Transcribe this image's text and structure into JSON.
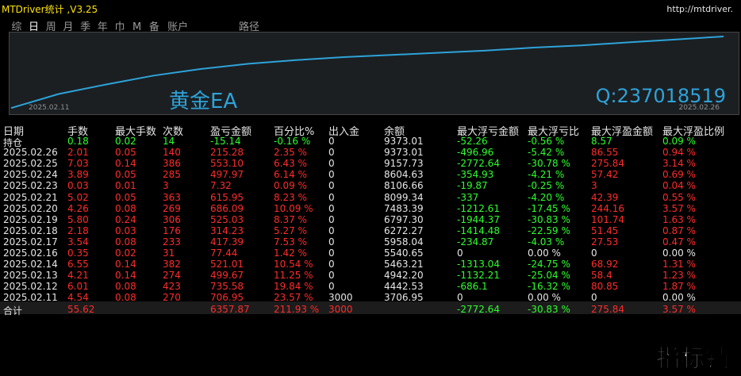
{
  "app": {
    "title": "MTDriver统计 ,V3.25",
    "url": "http://mtdriver."
  },
  "tabs": [
    "综",
    "日",
    "周",
    "月",
    "季",
    "年",
    "巾",
    "M",
    "备",
    "账户"
  ],
  "active_tab": "日",
  "route_label": "路径",
  "chart": {
    "label_left": "黄金EA",
    "label_right": "Q:237018519",
    "x_start": "2025.02.11",
    "x_end": "2025.02.26",
    "line_color": "#2ea3d9",
    "curve": [
      0.03,
      0.22,
      0.35,
      0.47,
      0.56,
      0.63,
      0.68,
      0.72,
      0.75,
      0.78,
      0.81,
      0.85,
      0.88,
      0.92,
      0.96,
      1.0
    ]
  },
  "colors": {
    "white": "#e6e6e6",
    "green": "#2cff2c",
    "red": "#ff2b2b",
    "blue": "#2ea3d9"
  },
  "table": {
    "headers": [
      "日期",
      "手数",
      "最大手数",
      "次数",
      "盈亏金额",
      "百分比%",
      "出入金",
      "余额",
      "最大浮亏金额",
      "最大浮亏比",
      "最大浮盈金额",
      "最大浮盈比例"
    ],
    "rows": [
      {
        "date": "持仓",
        "lots": "0.18",
        "maxlots": "0.02",
        "times": "14",
        "pnl": "-15.14",
        "pct": "-0.16 %",
        "io": "0",
        "bal": "9373.01",
        "maxloss": "-52.26",
        "maxlosspct": "-0.56 %",
        "maxwin": "8.57",
        "maxwinpct": "0.09 %",
        "color": "green"
      },
      {
        "date": "2025.02.26",
        "lots": "2.01",
        "maxlots": "0.05",
        "times": "140",
        "pnl": "215.28",
        "pct": "2.35 %",
        "io": "0",
        "bal": "9373.01",
        "maxloss": "-496.96",
        "maxlosspct": "-5.42 %",
        "maxwin": "86.55",
        "maxwinpct": "0.94 %",
        "color": "red"
      },
      {
        "date": "2025.02.25",
        "lots": "7.03",
        "maxlots": "0.14",
        "times": "386",
        "pnl": "553.10",
        "pct": "6.43 %",
        "io": "0",
        "bal": "9157.73",
        "maxloss": "-2772.64",
        "maxlosspct": "-30.78 %",
        "maxwin": "275.84",
        "maxwinpct": "3.14 %",
        "color": "red"
      },
      {
        "date": "2025.02.24",
        "lots": "3.89",
        "maxlots": "0.05",
        "times": "285",
        "pnl": "497.97",
        "pct": "6.14 %",
        "io": "0",
        "bal": "8604.63",
        "maxloss": "-354.93",
        "maxlosspct": "-4.21 %",
        "maxwin": "57.42",
        "maxwinpct": "0.69 %",
        "color": "red"
      },
      {
        "date": "2025.02.23",
        "lots": "0.03",
        "maxlots": "0.01",
        "times": "3",
        "pnl": "7.32",
        "pct": "0.09 %",
        "io": "0",
        "bal": "8106.66",
        "maxloss": "-19.87",
        "maxlosspct": "-0.25 %",
        "maxwin": "3",
        "maxwinpct": "0.04 %",
        "color": "red"
      },
      {
        "date": "2025.02.21",
        "lots": "5.02",
        "maxlots": "0.05",
        "times": "363",
        "pnl": "615.95",
        "pct": "8.23 %",
        "io": "0",
        "bal": "8099.34",
        "maxloss": "-337",
        "maxlosspct": "-4.20 %",
        "maxwin": "42.39",
        "maxwinpct": "0.55 %",
        "color": "red"
      },
      {
        "date": "2025.02.20",
        "lots": "4.26",
        "maxlots": "0.08",
        "times": "269",
        "pnl": "686.09",
        "pct": "10.09 %",
        "io": "0",
        "bal": "7483.39",
        "maxloss": "-1212.61",
        "maxlosspct": "-17.45 %",
        "maxwin": "244.16",
        "maxwinpct": "3.57 %",
        "color": "red"
      },
      {
        "date": "2025.02.19",
        "lots": "5.80",
        "maxlots": "0.24",
        "times": "306",
        "pnl": "525.03",
        "pct": "8.37 %",
        "io": "0",
        "bal": "6797.30",
        "maxloss": "-1944.37",
        "maxlosspct": "-30.83 %",
        "maxwin": "101.74",
        "maxwinpct": "1.63 %",
        "color": "red"
      },
      {
        "date": "2025.02.18",
        "lots": "2.18",
        "maxlots": "0.03",
        "times": "176",
        "pnl": "314.23",
        "pct": "5.27 %",
        "io": "0",
        "bal": "6272.27",
        "maxloss": "-1414.48",
        "maxlosspct": "-22.59 %",
        "maxwin": "51.45",
        "maxwinpct": "0.87 %",
        "color": "red"
      },
      {
        "date": "2025.02.17",
        "lots": "3.54",
        "maxlots": "0.08",
        "times": "233",
        "pnl": "417.39",
        "pct": "7.53 %",
        "io": "0",
        "bal": "5958.04",
        "maxloss": "-234.87",
        "maxlosspct": "-4.03 %",
        "maxwin": "27.53",
        "maxwinpct": "0.47 %",
        "color": "red"
      },
      {
        "date": "2025.02.16",
        "lots": "0.35",
        "maxlots": "0.02",
        "times": "31",
        "pnl": "77.44",
        "pct": "1.42 %",
        "io": "0",
        "bal": "5540.65",
        "maxloss": "0",
        "maxlosspct": "0.00 %",
        "maxwin": "0",
        "maxwinpct": "0.00 %",
        "color": "red"
      },
      {
        "date": "2025.02.14",
        "lots": "6.55",
        "maxlots": "0.14",
        "times": "382",
        "pnl": "521.01",
        "pct": "10.54 %",
        "io": "0",
        "bal": "5463.21",
        "maxloss": "-1313.04",
        "maxlosspct": "-24.75 %",
        "maxwin": "68.92",
        "maxwinpct": "1.31 %",
        "color": "red"
      },
      {
        "date": "2025.02.13",
        "lots": "4.21",
        "maxlots": "0.14",
        "times": "274",
        "pnl": "499.67",
        "pct": "11.25 %",
        "io": "0",
        "bal": "4942.20",
        "maxloss": "-1132.21",
        "maxlosspct": "-25.04 %",
        "maxwin": "58.4",
        "maxwinpct": "1.23 %",
        "color": "red"
      },
      {
        "date": "2025.02.12",
        "lots": "6.01",
        "maxlots": "0.08",
        "times": "423",
        "pnl": "735.58",
        "pct": "19.84 %",
        "io": "0",
        "bal": "4442.53",
        "maxloss": "-686.1",
        "maxlosspct": "-16.32 %",
        "maxwin": "80.85",
        "maxwinpct": "1.87 %",
        "color": "red"
      },
      {
        "date": "2025.02.11",
        "lots": "4.54",
        "maxlots": "0.08",
        "times": "270",
        "pnl": "706.95",
        "pct": "23.57 %",
        "io": "3000",
        "bal": "3706.95",
        "maxloss": "0",
        "maxlosspct": "0.00 %",
        "maxwin": "0",
        "maxwinpct": "0.00 %",
        "color": "red"
      }
    ],
    "total": {
      "date": "合计",
      "lots": "55.62",
      "maxlots": "",
      "times": "",
      "pnl": "6357.87",
      "pct": "211.93 %",
      "io": "3000",
      "bal": "",
      "maxloss": "-2772.64",
      "maxlosspct": "-30.83 %",
      "maxwin": "275.84",
      "maxwinpct": "3.57 %"
    }
  },
  "watermark": "指标铺"
}
